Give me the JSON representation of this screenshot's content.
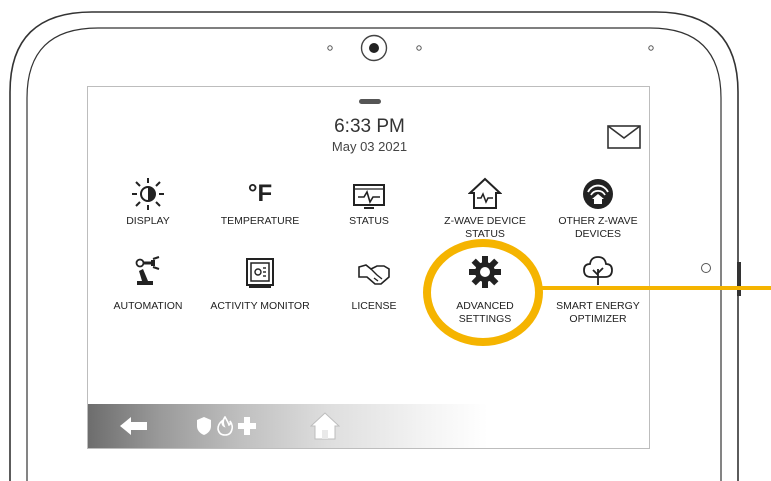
{
  "status": {
    "time": "6:33 PM",
    "date": "May 03 2021"
  },
  "tiles": [
    {
      "label_line1": "DISPLAY",
      "label_line2": "",
      "icon": "display-brightness-icon"
    },
    {
      "label_line1": "TEMPERATURE",
      "label_line2": "",
      "icon": "temperature-icon",
      "icon_text": "°F"
    },
    {
      "label_line1": "STATUS",
      "label_line2": "",
      "icon": "status-monitor-icon"
    },
    {
      "label_line1": "Z-WAVE DEVICE",
      "label_line2": "STATUS",
      "icon": "zwave-house-icon"
    },
    {
      "label_line1": "OTHER Z-WAVE",
      "label_line2": "DEVICES",
      "icon": "zwave-devices-icon"
    },
    {
      "label_line1": "AUTOMATION",
      "label_line2": "",
      "icon": "robot-arm-icon"
    },
    {
      "label_line1": "ACTIVITY MONITOR",
      "label_line2": "",
      "icon": "activity-monitor-icon"
    },
    {
      "label_line1": "LICENSE",
      "label_line2": "",
      "icon": "handshake-icon"
    },
    {
      "label_line1": "ADVANCED",
      "label_line2": "SETTINGS",
      "icon": "gear-icon"
    },
    {
      "label_line1": "SMART ENERGY",
      "label_line2": "OPTIMIZER",
      "icon": "tree-icon"
    }
  ],
  "nav": {
    "icons": [
      "back-arrow-icon",
      "shield-icon",
      "fire-icon",
      "medical-cross-icon",
      "home-icon"
    ]
  },
  "colors": {
    "highlight": "#f5b400",
    "frame": "#333333",
    "navbar_dark": "#6d6d6d"
  }
}
